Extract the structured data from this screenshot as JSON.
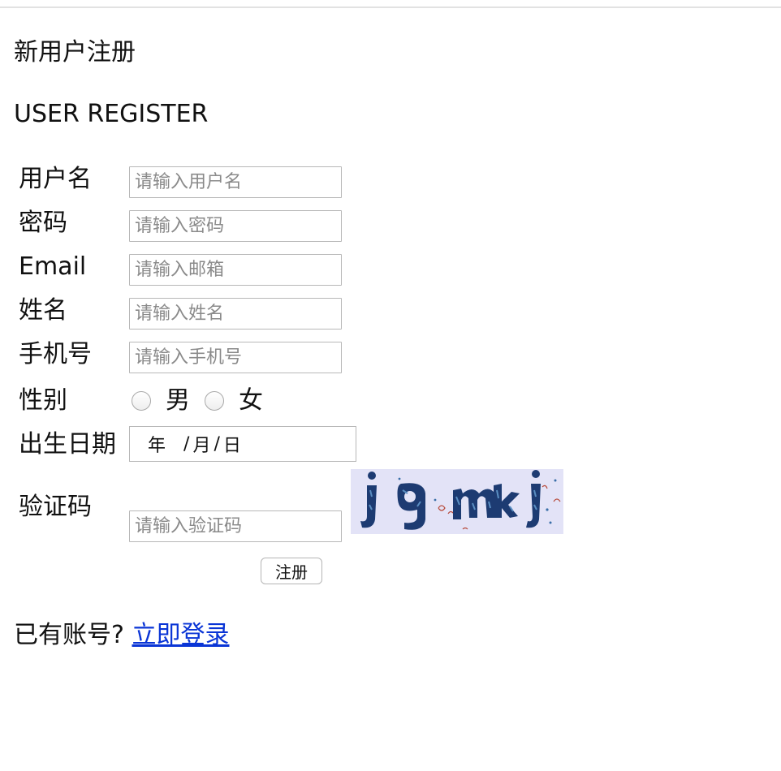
{
  "header": {
    "title_cn": "新用户注册",
    "title_en": "USER REGISTER"
  },
  "form": {
    "username": {
      "label": "用户名",
      "placeholder": "请输入用户名",
      "value": ""
    },
    "password": {
      "label": "密码",
      "placeholder": "请输入密码",
      "value": ""
    },
    "email": {
      "label": "Email",
      "placeholder": "请输入邮箱",
      "value": ""
    },
    "name": {
      "label": "姓名",
      "placeholder": "请输入姓名",
      "value": ""
    },
    "phone": {
      "label": "手机号",
      "placeholder": "请输入手机号",
      "value": ""
    },
    "gender": {
      "label": "性别",
      "options": [
        "男",
        "女"
      ]
    },
    "birthday": {
      "label": "出生日期",
      "year": "年",
      "month": "月",
      "day": "日",
      "separator": "/"
    },
    "captcha": {
      "label": "验证码",
      "placeholder": "请输入验证码",
      "value": "",
      "image_text": "jgmkj",
      "image_colors": {
        "background": "#e3e3f7",
        "glyph": "#1d3b72",
        "glyph_pattern": "#5a8ec2"
      }
    },
    "submit_label": "注册"
  },
  "footer": {
    "prompt": "已有账号?",
    "login_link": "立即登录"
  }
}
